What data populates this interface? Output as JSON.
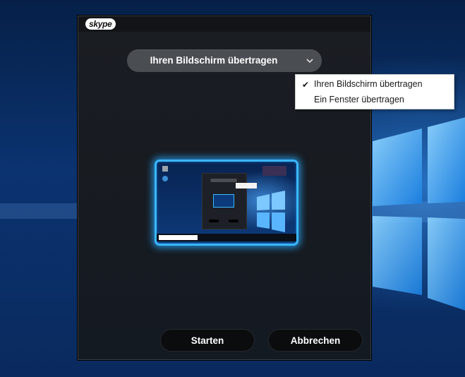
{
  "dialog": {
    "logo_text": "skype",
    "share_select": {
      "selected": "Ihren Bildschirm übertragen",
      "icon": "chevron-down-icon"
    },
    "preview": {
      "mini_search_placeholder": "Zur Suche Text hier eingeben"
    },
    "buttons": {
      "start": "Starten",
      "cancel": "Abbrechen"
    }
  },
  "dropdown": {
    "options": [
      {
        "label": "Ihren Bildschirm übertragen",
        "checked": true,
        "icon": "check-icon"
      },
      {
        "label": "Ein Fenster übertragen",
        "checked": false
      }
    ]
  },
  "colors": {
    "accent_glow": "#3ab7ff",
    "dialog_bg": "#1a1d22",
    "select_bg": "#4a4d52",
    "button_bg": "#0b0c0e"
  }
}
